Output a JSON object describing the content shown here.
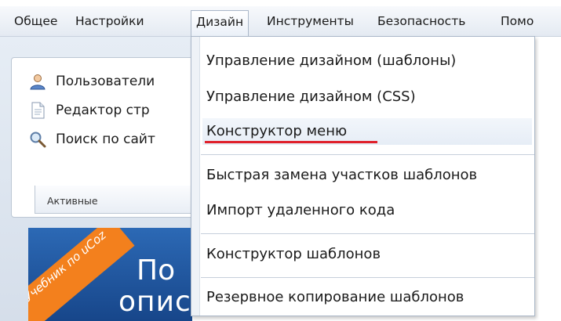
{
  "menubar": {
    "items": [
      {
        "label": "Общее"
      },
      {
        "label": "Настройки"
      },
      {
        "label": "Дизайн"
      },
      {
        "label": "Инструменты"
      },
      {
        "label": "Безопасность"
      },
      {
        "label": "Помо"
      }
    ]
  },
  "quick_links": [
    {
      "label": "Пользователи",
      "icon": "user-icon"
    },
    {
      "label": "Редактор стр",
      "icon": "page-icon"
    },
    {
      "label": "Поиск по сайт",
      "icon": "search-icon"
    }
  ],
  "tabs": {
    "active_label": "Активные"
  },
  "banner": {
    "ribbon_text": "Учебник по uCoz",
    "line1": "По",
    "line2": "описс"
  },
  "dropdown": {
    "items": [
      {
        "label": "Управление дизайном (шаблоны)"
      },
      {
        "label": "Управление дизайном (CSS)"
      },
      {
        "label": "Конструктор меню"
      },
      {
        "label": "Быстрая замена участков шаблонов"
      },
      {
        "label": "Импорт удаленного кода"
      },
      {
        "label": "Конструктор шаблонов"
      },
      {
        "label": "Резервное копирование шаблонов"
      }
    ]
  },
  "colors": {
    "highlight_underline": "#e0202a",
    "banner_blue": "#17468a",
    "ribbon_orange": "#f3801d"
  }
}
